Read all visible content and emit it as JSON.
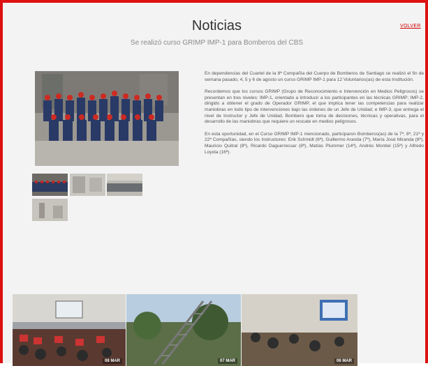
{
  "header": {
    "title": "Noticias",
    "subtitle": "Se realizó curso GRIMP IMP-1 para Bomberos del CBS",
    "back_label": "VOLVER"
  },
  "article": {
    "paragraphs": [
      "En dependencias del Cuartel de la 8ª Compañía del Cuerpo de Bomberos de Santiago se realizó el fin de semana pasado, 4, 5 y 6 de agosto un curso GRIMP IMP-1 para 12 Voluntarios(as) de esta Institución.",
      "Recordemos que los cursos GRIMP (Grupo de Reconocimiento e Intervención en Medios Peligrosos) se presentan en tres niveles: IMP-1, orientado a introducir a los participantes en las técnicas GRIMP; IMP-2, dirigido a obtener el grado de Operador GRIMP, el que implica tener las competencias para realizar maniobras en todo tipo de intervenciones bajo las órdenes de un Jefe de Unidad; e IMP-3, que entrega el nivel de Instructor y Jefe de Unidad, Bombero que toma de decisiones, técnicas y operativas, para el desarrollo de las maniobras que requiere un rescate en medios peligrosos.",
      "En esta oportunidad, en el Curso GRIMP IMP-1 mencionado, participaron Bomberos(as) de la 7ª, 8ª, 21ª y 22ª Compañías, siendo los Instructores: Erik Schmidt (6ª), Guillermo Aranda (7ª), María José Miranda (8ª), Mauricio Quitral (8ª), Ricardo Daguerressar (8ª), Matías Plummer (14ª), Andrés Montiel (15ª) y Alfredo Loyola (16ª)."
    ]
  },
  "gallery": {
    "main_icon": "group-photo-image",
    "thumbnails": [
      "group-photo-thumb",
      "training-room-thumb",
      "group-photo-thumb-2",
      "classroom-thumb"
    ]
  },
  "news_strip": [
    {
      "date": "08 MAR",
      "icon": "auditorium-photo"
    },
    {
      "date": "07 MAR",
      "icon": "ladder-tower-photo"
    },
    {
      "date": "06 MAR",
      "icon": "classroom-photo"
    }
  ],
  "colors": {
    "accent": "#dd1111",
    "link": "#cc0000",
    "background": "#f3f3f3"
  }
}
